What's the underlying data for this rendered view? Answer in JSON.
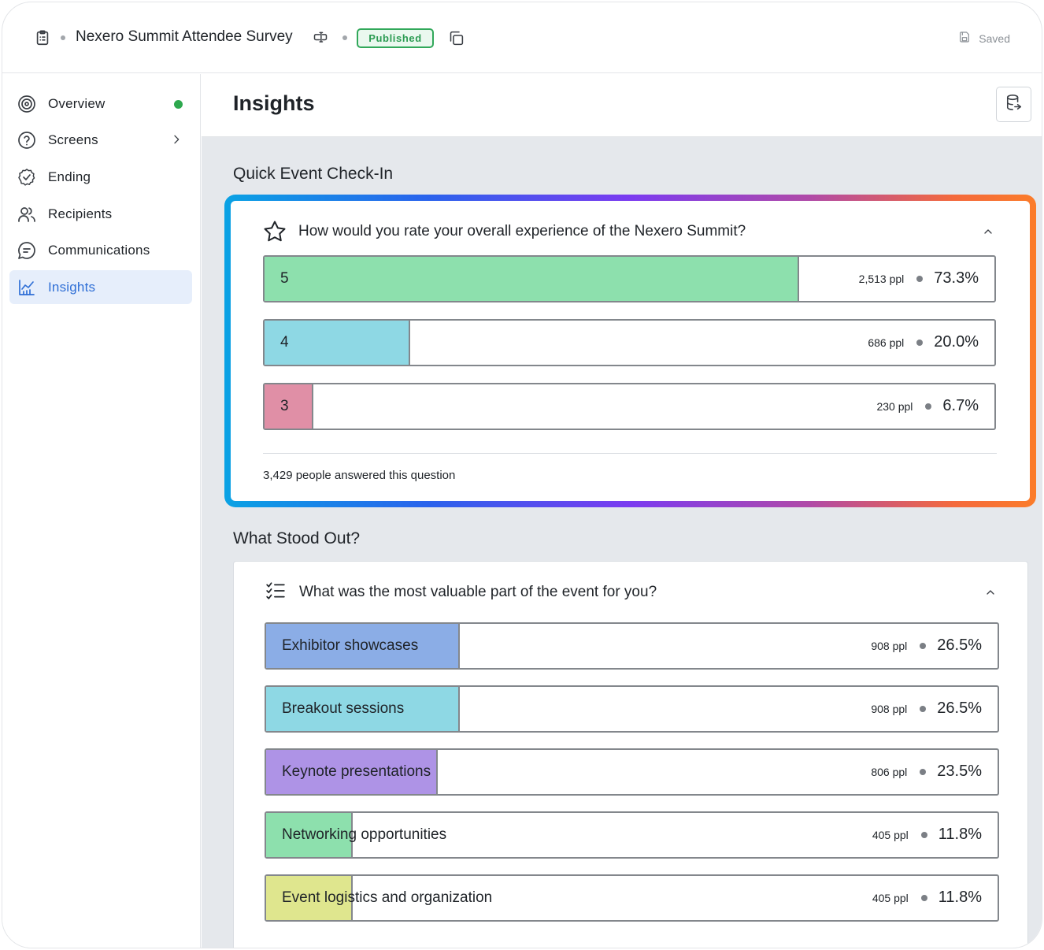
{
  "topbar": {
    "survey_title": "Nexero Summit Attendee Survey",
    "status_badge": "Published",
    "saved_label": "Saved"
  },
  "sidebar": {
    "items": [
      {
        "label": "Overview",
        "icon": "target-icon"
      },
      {
        "label": "Screens",
        "icon": "question-circle-icon"
      },
      {
        "label": "Ending",
        "icon": "check-circle-icon"
      },
      {
        "label": "Recipients",
        "icon": "users-icon"
      },
      {
        "label": "Communications",
        "icon": "message-icon"
      },
      {
        "label": "Insights",
        "icon": "chart-icon",
        "active": true
      }
    ]
  },
  "page": {
    "title": "Insights"
  },
  "section1": {
    "title": "Quick Event Check-In",
    "question": "How would you rate your overall experience of the Nexero Summit?",
    "answered": "3,429 people answered this question",
    "results": [
      {
        "label": "5",
        "count": "2,513 ppl",
        "pct": "73.3%",
        "fraction": 0.733,
        "color": "#8de0ad"
      },
      {
        "label": "4",
        "count": "686 ppl",
        "pct": "20.0%",
        "fraction": 0.2,
        "color": "#8ed8e4"
      },
      {
        "label": "3",
        "count": "230 ppl",
        "pct": "6.7%",
        "fraction": 0.067,
        "color": "#e08fa6"
      }
    ]
  },
  "section2": {
    "title": "What Stood Out?",
    "question": "What was the most valuable part of the event for you?",
    "results": [
      {
        "label": "Exhibitor showcases",
        "count": "908 ppl",
        "pct": "26.5%",
        "fraction": 0.265,
        "color": "#8bade6"
      },
      {
        "label": "Breakout sessions",
        "count": "908 ppl",
        "pct": "26.5%",
        "fraction": 0.265,
        "color": "#8ed8e4"
      },
      {
        "label": "Keynote presentations",
        "count": "806 ppl",
        "pct": "23.5%",
        "fraction": 0.235,
        "color": "#ae93e6"
      },
      {
        "label": "Networking opportunities",
        "count": "405 ppl",
        "pct": "11.8%",
        "fraction": 0.118,
        "color": "#8de0ad"
      },
      {
        "label": "Event logistics and organization",
        "count": "405 ppl",
        "pct": "11.8%",
        "fraction": 0.118,
        "color": "#dfe68e"
      }
    ]
  },
  "colors": {
    "accent": "#2f6fd6",
    "published": "#2b9b52",
    "online_dot": "#2da84e"
  }
}
